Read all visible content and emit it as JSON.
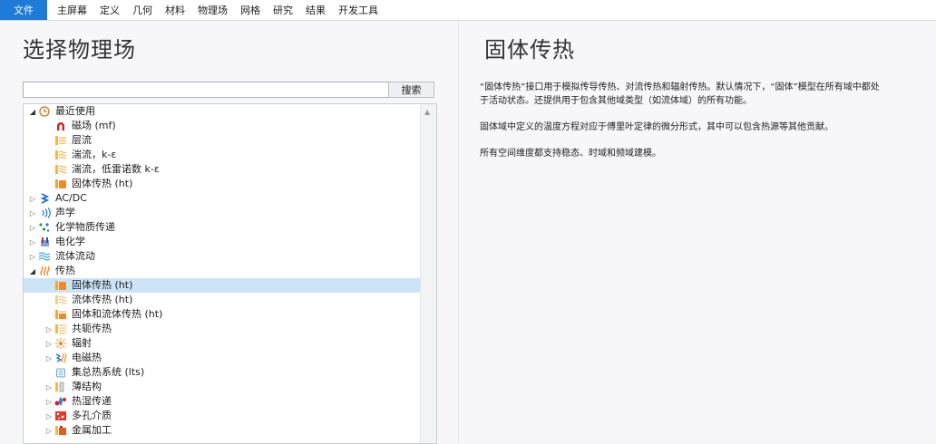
{
  "menubar": {
    "items": [
      "文件",
      "主屏幕",
      "定义",
      "几何",
      "材料",
      "物理场",
      "网格",
      "研究",
      "结果",
      "开发工具"
    ]
  },
  "left": {
    "title": "选择物理场",
    "search": {
      "value": "",
      "button_label": "搜索"
    }
  },
  "tree": {
    "items": [
      {
        "label": "最近使用",
        "level": 1,
        "arrow": "expanded",
        "icon": "recent-clock-icon"
      },
      {
        "label": "磁场 (mf)",
        "level": 2,
        "arrow": "none",
        "icon": "magnet-icon"
      },
      {
        "label": "层流",
        "level": 2,
        "arrow": "none",
        "icon": "laminar-flow-icon"
      },
      {
        "label": "湍流，k-ε",
        "level": 2,
        "arrow": "none",
        "icon": "turbulent-flow-icon"
      },
      {
        "label": "湍流，低雷诺数 k-ε",
        "level": 2,
        "arrow": "none",
        "icon": "turbulent-flow-icon"
      },
      {
        "label": "固体传热 (ht)",
        "level": 2,
        "arrow": "none",
        "icon": "heat-solid-icon"
      },
      {
        "label": "AC/DC",
        "level": 1,
        "arrow": "collapsed",
        "icon": "acdc-icon"
      },
      {
        "label": "声学",
        "level": 1,
        "arrow": "collapsed",
        "icon": "acoustics-icon"
      },
      {
        "label": "化学物质传递",
        "level": 1,
        "arrow": "collapsed",
        "icon": "chemical-transport-icon"
      },
      {
        "label": "电化学",
        "level": 1,
        "arrow": "collapsed",
        "icon": "electrochemistry-icon"
      },
      {
        "label": "流体流动",
        "level": 1,
        "arrow": "collapsed",
        "icon": "fluid-flow-icon"
      },
      {
        "label": "传热",
        "level": 1,
        "arrow": "expanded",
        "icon": "heat-transfer-icon"
      },
      {
        "label": "固体传热 (ht)",
        "level": 2,
        "arrow": "none",
        "icon": "heat-solid-icon",
        "selected": true
      },
      {
        "label": "流体传热 (ht)",
        "level": 2,
        "arrow": "none",
        "icon": "heat-fluid-icon"
      },
      {
        "label": "固体和流体传热 (ht)",
        "level": 2,
        "arrow": "none",
        "icon": "heat-solid-fluid-icon"
      },
      {
        "label": "共轭传热",
        "level": 2,
        "arrow": "collapsed",
        "icon": "conjugate-heat-icon"
      },
      {
        "label": "辐射",
        "level": 2,
        "arrow": "collapsed",
        "icon": "radiation-icon"
      },
      {
        "label": "电磁热",
        "level": 2,
        "arrow": "collapsed",
        "icon": "electromagnetic-heat-icon"
      },
      {
        "label": "集总热系统 (lts)",
        "level": 2,
        "arrow": "none",
        "icon": "lumped-thermal-icon"
      },
      {
        "label": "薄结构",
        "level": 2,
        "arrow": "collapsed",
        "icon": "thin-structure-icon"
      },
      {
        "label": "热湿传递",
        "level": 2,
        "arrow": "collapsed",
        "icon": "moisture-heat-icon"
      },
      {
        "label": "多孔介质",
        "level": 2,
        "arrow": "collapsed",
        "icon": "porous-media-icon"
      },
      {
        "label": "金属加工",
        "level": 2,
        "arrow": "collapsed",
        "icon": "metal-processing-icon"
      }
    ]
  },
  "right": {
    "title": "固体传热",
    "paragraphs": [
      "“固体传热”接口用于模拟传导传热、对流传热和辐射传热。默认情况下，“固体”模型在所有域中都处于活动状态。还提供用于包含其他域类型（如流体域）的所有功能。",
      "固体域中定义的温度方程对应于傅里叶定律的微分形式，其中可以包含热源等其他贡献。",
      "所有空间维度都支持稳态、时域和频域建模。"
    ]
  },
  "colors": {
    "accent": "#1e7bd8",
    "selected_row": "#cce3f8",
    "heat_orange": "#f08a24",
    "flow_orange": "#f4b24a",
    "magnet_red": "#d3222a"
  }
}
